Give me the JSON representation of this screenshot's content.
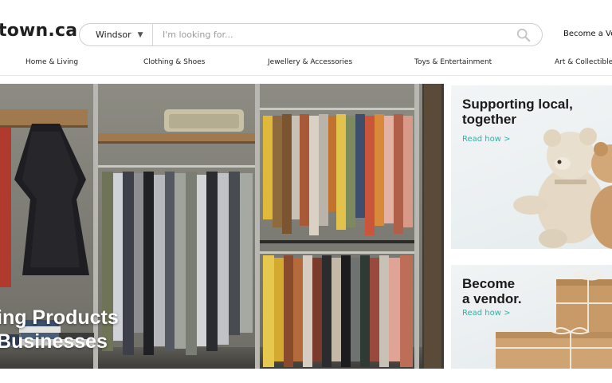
{
  "header": {
    "logo": "town.ca",
    "location_select": "Windsor",
    "search_placeholder": "I'm looking for...",
    "vendor_link": "Become a Ve"
  },
  "nav": [
    "Home & Living",
    "Clothing & Shoes",
    "Jewellery & Accessories",
    "Toys & Entertainment",
    "Art & Collectible"
  ],
  "hero": {
    "line1": "ing Products",
    "line2": "Businesses"
  },
  "cards": [
    {
      "title_line1": "Supporting local,",
      "title_line2": "together",
      "link": "Read how >"
    },
    {
      "title_line1": "Become",
      "title_line2": "a vendor.",
      "link": "Read how >"
    }
  ],
  "colors": {
    "accent": "#2bb3a6",
    "text": "#1a1a1a"
  },
  "icons": {
    "search": "search-icon",
    "caret": "chevron-down-icon"
  }
}
